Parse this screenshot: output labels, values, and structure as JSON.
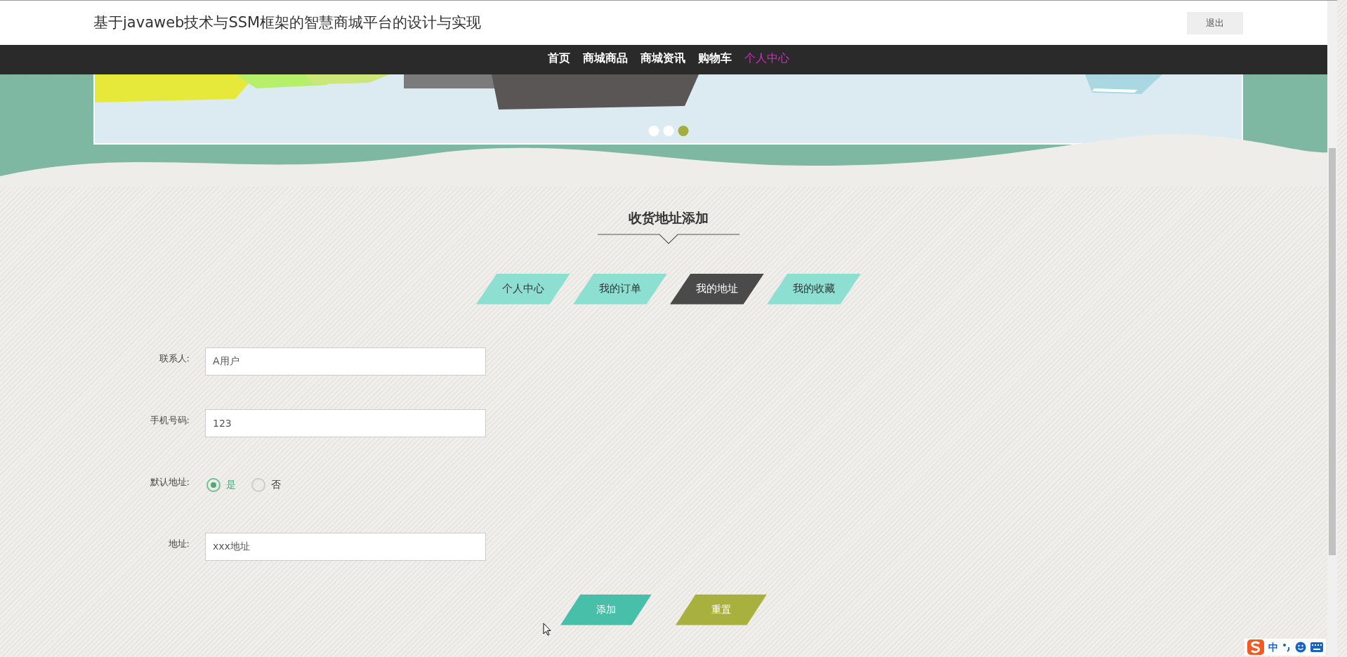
{
  "header": {
    "title": "基于javaweb技术与SSM框架的智慧商城平台的设计与实现",
    "logout": "退出"
  },
  "nav": [
    {
      "label": "首页",
      "selected": false
    },
    {
      "label": "商城商品",
      "selected": false
    },
    {
      "label": "商城资讯",
      "selected": false
    },
    {
      "label": "购物车",
      "selected": false
    },
    {
      "label": "个人中心",
      "selected": true
    }
  ],
  "banner": {
    "kind": "picture",
    "dots": [
      {
        "selected": false
      },
      {
        "selected": false
      },
      {
        "selected": true
      }
    ]
  },
  "section_title": "收货地址添加",
  "tabs": [
    {
      "label": "个人中心",
      "selected": false
    },
    {
      "label": "我的订单",
      "selected": false
    },
    {
      "label": "我的地址",
      "selected": true
    },
    {
      "label": "我的收藏",
      "selected": false
    }
  ],
  "form": [
    {
      "kind": "text",
      "label": "联系人:",
      "value": "A用户"
    },
    {
      "kind": "text",
      "label": "手机号码:",
      "value": "123"
    },
    {
      "kind": "radio",
      "label": "默认地址:",
      "options": [
        {
          "label": "是",
          "selected": true
        },
        {
          "label": "否",
          "selected": false
        }
      ]
    },
    {
      "kind": "text",
      "label": "地址:",
      "value": "xxx地址"
    }
  ],
  "buttons": [
    {
      "label": "添加",
      "kind": "primary"
    },
    {
      "label": "重置",
      "kind": "secondary"
    }
  ],
  "ime_toolbar": {
    "mode": "中"
  }
}
